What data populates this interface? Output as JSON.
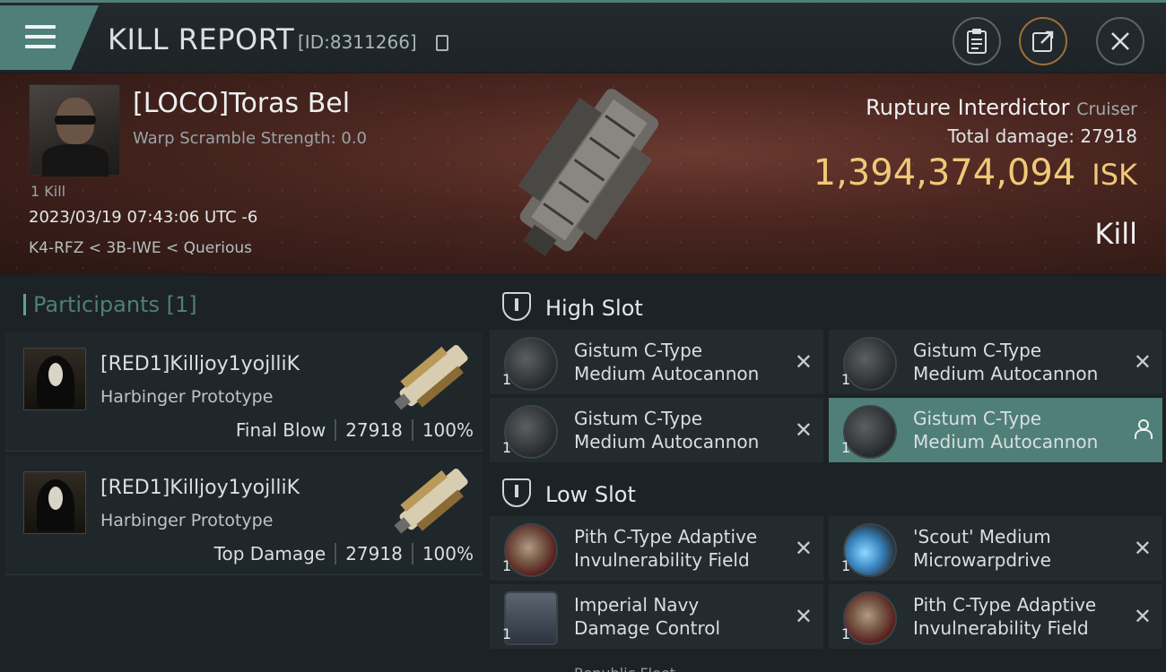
{
  "header": {
    "title": "KILL REPORT",
    "report_id": "[ID:8311266]",
    "icons": [
      "menu-icon",
      "copy-icon",
      "clipboard-icon",
      "share-icon",
      "close-icon"
    ]
  },
  "victim": {
    "name": "[LOCO]Toras Bel",
    "warp_scramble": "Warp Scramble Strength: 0.0",
    "kill_count": "1 Kill",
    "datetime": "2023/03/19 07:43:06 UTC -6",
    "location": "K4-RFZ < 3B-IWE < Querious",
    "ship_name": "Rupture Interdictor",
    "ship_class": "Cruiser",
    "total_damage_label": "Total damage:",
    "total_damage": "27918",
    "isk_value": "1,394,374,094",
    "isk_unit": "ISK",
    "result": "Kill"
  },
  "participants": {
    "title": "Participants",
    "count": "[1]",
    "rows": [
      {
        "name": "[RED1]Killjoy1yojlliK",
        "ship": "Harbinger Prototype",
        "role": "Final Blow",
        "damage": "27918",
        "percent": "100%"
      },
      {
        "name": "[RED1]Killjoy1yojlliK",
        "ship": "Harbinger Prototype",
        "role": "Top Damage",
        "damage": "27918",
        "percent": "100%"
      }
    ]
  },
  "slots": {
    "high_label": "High Slot",
    "low_label": "Low Slot",
    "high": [
      {
        "line1": "Gistum C-Type",
        "line2": "Medium Autocannon",
        "qty": "1"
      },
      {
        "line1": "Gistum C-Type",
        "line2": "Medium Autocannon",
        "qty": "1"
      },
      {
        "line1": "Gistum C-Type",
        "line2": "Medium Autocannon",
        "qty": "1"
      },
      {
        "line1": "Gistum C-Type",
        "line2": "Medium Autocannon",
        "qty": "1"
      }
    ],
    "low": [
      {
        "line1": "Pith C-Type Adaptive",
        "line2": "Invulnerability Field",
        "qty": "1"
      },
      {
        "line1": "'Scout' Medium",
        "line2": "Microwarpdrive",
        "qty": "1"
      },
      {
        "line1": "Imperial Navy",
        "line2": "Damage Control",
        "qty": "1"
      },
      {
        "line1": "Pith C-Type Adaptive",
        "line2": "Invulnerability Field",
        "qty": "1"
      }
    ],
    "cut_off": "Republic Fleet"
  },
  "colors": {
    "accent": "#4f7f78",
    "isk": "#f0c878"
  }
}
